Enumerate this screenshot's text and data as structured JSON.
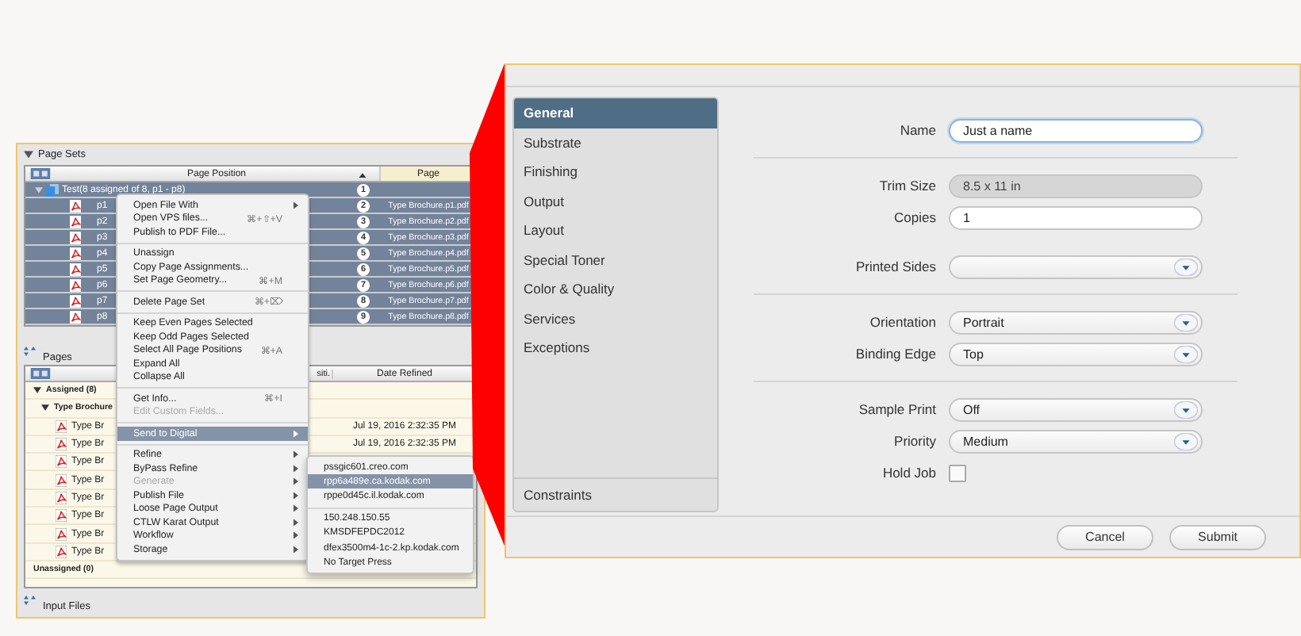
{
  "left_panel": {
    "page_sets": {
      "title": "Page Sets",
      "columns": [
        "Page Position",
        "Page"
      ],
      "rows": [
        {
          "kind": "group",
          "label": "Test(8 assigned of 8, p1 - p8)",
          "badge": "1",
          "selected": true
        },
        {
          "kind": "page",
          "label": "p1",
          "badge": "2",
          "page": "Type Brochure.p1.pdf",
          "selected": true
        },
        {
          "kind": "page",
          "label": "p2",
          "badge": "3",
          "page": "Type Brochure.p2.pdf",
          "selected": true
        },
        {
          "kind": "page",
          "label": "p3",
          "badge": "4",
          "page": "Type Brochure.p3.pdf",
          "selected": true
        },
        {
          "kind": "page",
          "label": "p4",
          "badge": "5",
          "page": "Type Brochure.p4.pdf",
          "selected": true
        },
        {
          "kind": "page",
          "label": "p5",
          "badge": "6",
          "page": "Type Brochure.p5.pdf",
          "selected": true
        },
        {
          "kind": "page",
          "label": "p6",
          "badge": "7",
          "page": "Type Brochure.p6.pdf",
          "selected": true
        },
        {
          "kind": "page",
          "label": "p7",
          "badge": "8",
          "page": "Type Brochure.p7.pdf",
          "selected": true
        },
        {
          "kind": "page",
          "label": "p8",
          "badge": "9",
          "page": "Type Brochure.p8.pdf",
          "selected": true
        }
      ]
    },
    "pages": {
      "title": "Pages",
      "columns": [
        "siti.",
        "Date Refined"
      ],
      "tree": [
        {
          "label": "Assigned (8)",
          "children": [
            {
              "label": "Type Brochure",
              "children": [
                {
                  "label": "Type Br",
                  "date": "Jul 19, 2016 2:32:35 PM"
                },
                {
                  "label": "Type Br",
                  "date": "Jul 19, 2016 2:32:35 PM"
                },
                {
                  "label": "Type Br"
                },
                {
                  "label": "Type Br"
                },
                {
                  "label": "Type Br"
                },
                {
                  "label": "Type Br"
                },
                {
                  "label": "Type Br"
                },
                {
                  "label": "Type Br"
                }
              ]
            }
          ]
        },
        {
          "label": "Unassigned (0)"
        }
      ]
    },
    "input_files": {
      "title": "Input Files"
    },
    "context_menu": [
      {
        "kind": "item",
        "label": "Open File With",
        "submenu": true,
        "disabled": false,
        "selected": false
      },
      {
        "kind": "item",
        "label": "Open VPS files...",
        "shortcut": "⌘+⇧+V",
        "submenu": false,
        "disabled": false,
        "selected": false
      },
      {
        "kind": "item",
        "label": "Publish to PDF File...",
        "submenu": false,
        "disabled": false,
        "selected": false
      },
      {
        "kind": "separator"
      },
      {
        "kind": "item",
        "label": "Unassign",
        "submenu": false,
        "disabled": false,
        "selected": false
      },
      {
        "kind": "item",
        "label": "Copy Page Assignments...",
        "submenu": false,
        "disabled": false,
        "selected": false
      },
      {
        "kind": "item",
        "label": "Set Page Geometry...",
        "shortcut": "⌘+M",
        "submenu": false,
        "disabled": false,
        "selected": false
      },
      {
        "kind": "separator"
      },
      {
        "kind": "item",
        "label": "Delete Page Set",
        "shortcut": "⌘+⌦",
        "submenu": false,
        "disabled": false,
        "selected": false
      },
      {
        "kind": "separator"
      },
      {
        "kind": "item",
        "label": "Keep Even Pages Selected",
        "submenu": false,
        "disabled": false,
        "selected": false
      },
      {
        "kind": "item",
        "label": "Keep Odd Pages Selected",
        "submenu": false,
        "disabled": false,
        "selected": false
      },
      {
        "kind": "item",
        "label": "Select All Page Positions",
        "shortcut": "⌘+A",
        "submenu": false,
        "disabled": false,
        "selected": false
      },
      {
        "kind": "item",
        "label": "Expand All",
        "submenu": false,
        "disabled": false,
        "selected": false
      },
      {
        "kind": "item",
        "label": "Collapse All",
        "submenu": false,
        "disabled": false,
        "selected": false
      },
      {
        "kind": "separator"
      },
      {
        "kind": "item",
        "label": "Get Info...",
        "shortcut": "⌘+I",
        "submenu": false,
        "disabled": false,
        "selected": false
      },
      {
        "kind": "item",
        "label": "Edit Custom Fields...",
        "submenu": false,
        "disabled": true,
        "selected": false
      },
      {
        "kind": "separator"
      },
      {
        "kind": "item",
        "label": "Send to Digital",
        "submenu": true,
        "disabled": false,
        "selected": true
      },
      {
        "kind": "separator"
      },
      {
        "kind": "item",
        "label": "Refine",
        "submenu": true,
        "disabled": false,
        "selected": false
      },
      {
        "kind": "item",
        "label": "ByPass Refine",
        "submenu": true,
        "disabled": false,
        "selected": false
      },
      {
        "kind": "item",
        "label": "Generate",
        "submenu": true,
        "disabled": true,
        "selected": false
      },
      {
        "kind": "item",
        "label": "Publish File",
        "submenu": true,
        "disabled": false,
        "selected": false
      },
      {
        "kind": "item",
        "label": "Loose Page Output",
        "submenu": true,
        "disabled": false,
        "selected": false
      },
      {
        "kind": "item",
        "label": "CTLW Karat Output",
        "submenu": true,
        "disabled": false,
        "selected": false
      },
      {
        "kind": "item",
        "label": "Workflow",
        "submenu": true,
        "disabled": false,
        "selected": false
      },
      {
        "kind": "item",
        "label": "Storage",
        "submenu": true,
        "disabled": false,
        "selected": false
      }
    ],
    "submenu": [
      {
        "kind": "item",
        "label": "pssgic601.creo.com",
        "selected": false
      },
      {
        "kind": "item",
        "label": "rpp6a489e.ca.kodak.com",
        "selected": true
      },
      {
        "kind": "item",
        "label": "rppe0d45c.il.kodak.com",
        "selected": false
      },
      {
        "kind": "separator"
      },
      {
        "kind": "item",
        "label": "150.248.150.55",
        "selected": false
      },
      {
        "kind": "item",
        "label": "KMSDFEPDC2012",
        "selected": false
      },
      {
        "kind": "item",
        "label": "dfex3500m4-1c-2.kp.kodak.com",
        "selected": false
      },
      {
        "kind": "item",
        "label": "No Target Press",
        "selected": false
      }
    ]
  },
  "right_panel": {
    "sidebar": {
      "items": [
        {
          "label": "General",
          "selected": true
        },
        {
          "label": "Substrate",
          "selected": false
        },
        {
          "label": "Finishing",
          "selected": false
        },
        {
          "label": "Output",
          "selected": false
        },
        {
          "label": "Layout",
          "selected": false
        },
        {
          "label": "Special Toner",
          "selected": false
        },
        {
          "label": "Color & Quality",
          "selected": false
        },
        {
          "label": "Services",
          "selected": false
        },
        {
          "label": "Exceptions",
          "selected": false
        }
      ],
      "footer_item": {
        "label": "Constraints",
        "selected": false
      }
    },
    "form": {
      "groups": [
        {
          "divider": true,
          "fields": [
            {
              "kind": "text",
              "label": "Name",
              "value": "Just a name",
              "disabled": false,
              "focused": true
            }
          ]
        },
        {
          "divider": false,
          "fields": [
            {
              "kind": "text",
              "label": "Trim Size",
              "value": "8.5 x 11 in",
              "disabled": true,
              "focused": false
            },
            {
              "kind": "text",
              "label": "Copies",
              "value": "1",
              "disabled": false,
              "focused": false
            }
          ]
        },
        {
          "divider": true,
          "fields": [
            {
              "kind": "select",
              "label": "Printed Sides"
            }
          ]
        },
        {
          "divider": true,
          "fields": [
            {
              "kind": "select",
              "label": "Orientation",
              "value": "Portrait"
            },
            {
              "kind": "select",
              "label": "Binding Edge",
              "value": "Top"
            }
          ]
        },
        {
          "divider": false,
          "fields": [
            {
              "kind": "select",
              "label": "Sample Print",
              "value": "Off"
            },
            {
              "kind": "select",
              "label": "Priority",
              "value": "Medium"
            },
            {
              "kind": "checkbox",
              "label": "Hold Job",
              "checked": false
            }
          ]
        }
      ]
    },
    "buttons": [
      "Cancel",
      "Submit"
    ]
  }
}
